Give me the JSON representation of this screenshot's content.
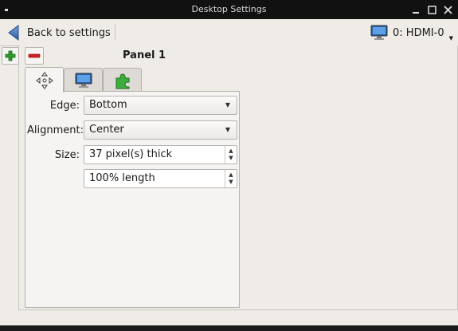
{
  "window": {
    "title": "Desktop Settings"
  },
  "toolbar": {
    "back_label": "Back to settings",
    "monitor_label": "0: HDMI-0"
  },
  "panel": {
    "title": "Panel 1",
    "tabs": [
      {
        "icon": "move-arrows-icon",
        "active": true
      },
      {
        "icon": "monitor-icon",
        "active": false
      },
      {
        "icon": "puzzle-piece-icon",
        "active": false
      }
    ],
    "edge_label": "Edge:",
    "edge_value": "Bottom",
    "alignment_label": "Alignment:",
    "alignment_value": "Center",
    "size_label": "Size:",
    "size_value": "37 pixel(s) thick",
    "length_value": "100% length"
  },
  "colors": {
    "add_green": "#2e9e2e",
    "remove_red": "#d42020",
    "back_blue": "#3b6fb6"
  }
}
